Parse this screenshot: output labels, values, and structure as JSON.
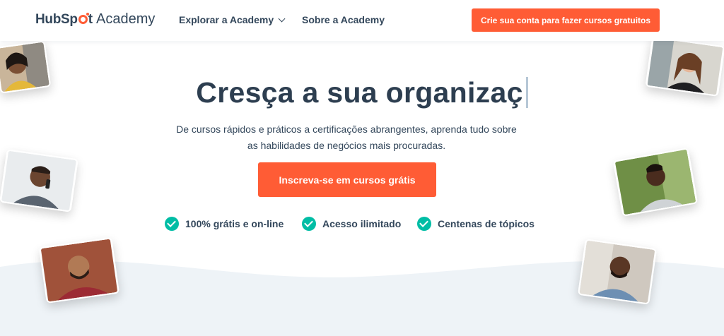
{
  "brand": {
    "logo_hub": "HubSp",
    "logo_t": "t",
    "logo_academy": "Academy"
  },
  "nav": {
    "explore_label": "Explorar a Academy",
    "about_label": "Sobre a Academy",
    "signup_label": "Crie sua conta para fazer cursos gratuitos"
  },
  "hero": {
    "title": "Cresça a sua organizaç",
    "subtitle_line1": "De cursos rápidos e práticos a certificações abrangentes, aprenda tudo sobre",
    "subtitle_line2": "as habilidades de negócios mais procuradas.",
    "cta_label": "Inscreva-se em cursos grátis"
  },
  "features": [
    {
      "label": "100% grátis e on-line",
      "icon": "check-circle-icon"
    },
    {
      "label": "Acesso ilimitado",
      "icon": "check-circle-icon"
    },
    {
      "label": "Centenas de tópicos",
      "icon": "check-circle-icon"
    }
  ],
  "colors": {
    "accent": "#ff5c35",
    "check": "#00bda5",
    "text": "#33475b",
    "wave": "#eef3f7"
  }
}
